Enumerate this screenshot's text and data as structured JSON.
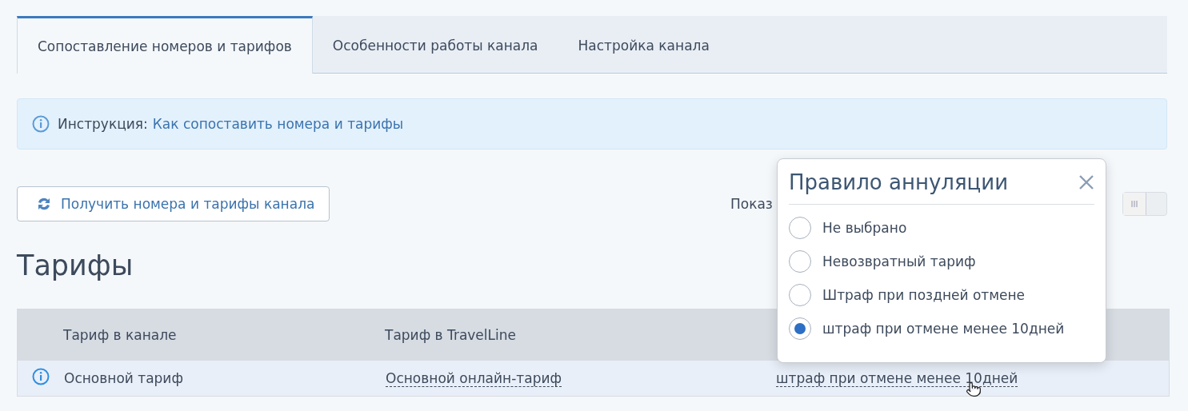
{
  "tabs": [
    {
      "label": "Сопоставление номеров и тарифов",
      "selected": true
    },
    {
      "label": "Особенности работы канала",
      "selected": false
    },
    {
      "label": "Настройка канала",
      "selected": false
    }
  ],
  "notice": {
    "label": "Инструкция:",
    "link": "Как сопоставить номера и тарифы"
  },
  "fetch_button": "Получить номера и тарифы канала",
  "show_toggle": {
    "label": "Показ",
    "on": false
  },
  "section_title": "Тарифы",
  "table": {
    "columns": [
      "Тариф в канале",
      "Тариф в TravelLine"
    ],
    "rows": [
      {
        "channel_rate": "Основной тариф",
        "travelline_rate": "Основной онлайн-тариф",
        "cancellation": "штраф при отмене менее 10дней"
      }
    ]
  },
  "popup": {
    "title": "Правило аннуляции",
    "options": [
      {
        "label": "Не выбрано",
        "selected": false
      },
      {
        "label": "Невозвратный тариф",
        "selected": false
      },
      {
        "label": "Штраф при поздней отмене",
        "selected": false
      },
      {
        "label": "штраф при отмене менее 10дней",
        "selected": true
      }
    ]
  }
}
